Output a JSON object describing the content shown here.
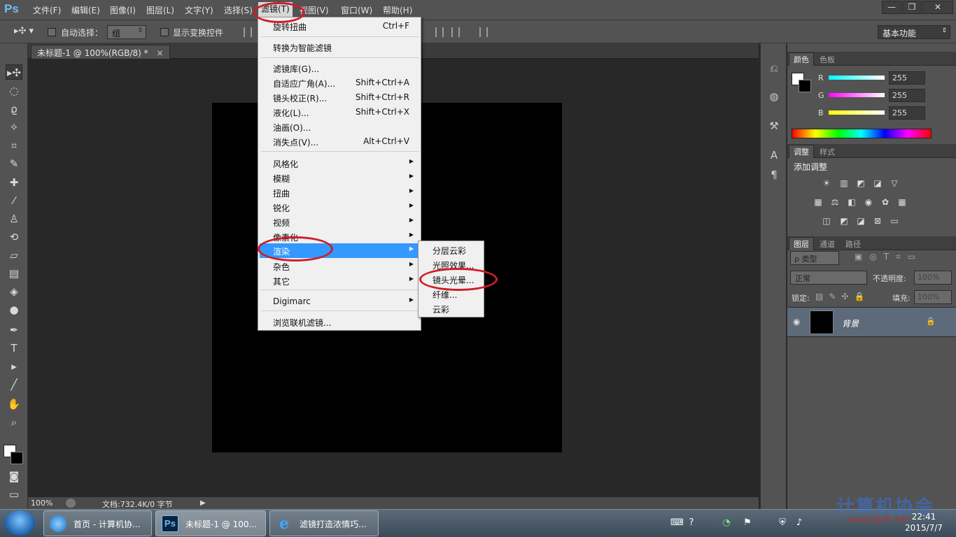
{
  "app": {
    "logo": "Ps"
  },
  "menubar": {
    "items": [
      "文件(F)",
      "编辑(E)",
      "图像(I)",
      "图层(L)",
      "文字(Y)",
      "选择(S)",
      "滤镜(T)",
      "视图(V)",
      "窗口(W)",
      "帮助(H)"
    ],
    "active": "滤镜(T)"
  },
  "window_controls": {
    "minimize": "—",
    "restore": "❐",
    "close": "✕"
  },
  "options": {
    "auto_select_label": "自动选择：",
    "auto_select_value": "组",
    "show_transform_label": "显示变换控件",
    "workspace": "基本功能"
  },
  "document": {
    "tab_title": "未标题-1 @ 100%(RGB/8) *",
    "close": "×"
  },
  "status": {
    "zoom": "100%",
    "docinfo": "文档:732.4K/0 字节"
  },
  "filter_menu": {
    "items": [
      {
        "label": "旋转扭曲",
        "shortcut": "Ctrl+F"
      },
      {
        "label": "转换为智能滤镜"
      },
      {
        "label": "滤镜库(G)..."
      },
      {
        "label": "自适应广角(A)...",
        "shortcut": "Shift+Ctrl+A"
      },
      {
        "label": "镜头校正(R)...",
        "shortcut": "Shift+Ctrl+R"
      },
      {
        "label": "液化(L)...",
        "shortcut": "Shift+Ctrl+X"
      },
      {
        "label": "油画(O)..."
      },
      {
        "label": "消失点(V)...",
        "shortcut": "Alt+Ctrl+V"
      },
      {
        "label": "风格化"
      },
      {
        "label": "模糊"
      },
      {
        "label": "扭曲"
      },
      {
        "label": "锐化"
      },
      {
        "label": "视频"
      },
      {
        "label": "像素化"
      },
      {
        "label": "渲染"
      },
      {
        "label": "杂色"
      },
      {
        "label": "其它"
      },
      {
        "label": "Digimarc"
      },
      {
        "label": "浏览联机滤镜..."
      }
    ],
    "highlighted": "渲染"
  },
  "render_submenu": {
    "items": [
      "分层云彩",
      "光照效果...",
      "镜头光晕...",
      "纤维...",
      "云彩"
    ],
    "circled": "镜头光晕..."
  },
  "color_panel": {
    "tabs": [
      "颜色",
      "色板"
    ],
    "channels": [
      {
        "name": "R",
        "value": "255",
        "color": "#00ffff"
      },
      {
        "name": "G",
        "value": "255",
        "color": "#ff00ff"
      },
      {
        "name": "B",
        "value": "255",
        "color": "#ffff00"
      }
    ]
  },
  "adjust_panel": {
    "tabs": [
      "调整",
      "样式"
    ],
    "title": "添加调整"
  },
  "layers_panel": {
    "tabs": [
      "图层",
      "通道",
      "路径"
    ],
    "kind_filter": "ρ 类型",
    "blend_mode": "正常",
    "opacity_label": "不透明度:",
    "opacity_value": "100%",
    "lock_label": "锁定:",
    "fill_label": "填充:",
    "fill_value": "100%",
    "layer_name": "背景"
  },
  "taskbar": {
    "tasks": [
      "首页 - 计算机协...",
      "未标题-1 @ 100...",
      "滤镜打造浓情巧..."
    ],
    "time": "22:41",
    "date": "2015/7/7",
    "watermark": "计算机协会",
    "watermark_url": "www.jsjxh.net"
  }
}
